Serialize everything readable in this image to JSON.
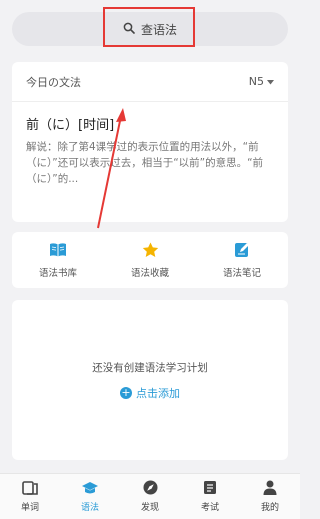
{
  "search": {
    "placeholder": "查语法"
  },
  "grammar_of_day": {
    "header": "今日の文法",
    "level": "N5",
    "title": "前（に）[时间]",
    "description": "解说：除了第4课学过的表示位置的用法以外，“前（に）”还可以表示过去，相当于“以前”的意思。“前（に）”的..."
  },
  "tools": [
    {
      "label": "语法书库",
      "icon": "book-icon"
    },
    {
      "label": "语法收藏",
      "icon": "star-icon"
    },
    {
      "label": "语法笔记",
      "icon": "note-icon"
    }
  ],
  "plan": {
    "empty_text": "还没有创建语法学习计划",
    "add_label": "点击添加"
  },
  "tabs": [
    {
      "label": "单词",
      "icon": "flashcard-icon",
      "active": false
    },
    {
      "label": "语法",
      "icon": "graduation-cap-icon",
      "active": true
    },
    {
      "label": "发现",
      "icon": "compass-icon",
      "active": false
    },
    {
      "label": "考试",
      "icon": "exam-icon",
      "active": false
    },
    {
      "label": "我的",
      "icon": "person-icon",
      "active": false
    }
  ],
  "colors": {
    "accent": "#2a9bd6",
    "star": "#f5b400",
    "annotation": "#e53935",
    "background": "#f2f2f4"
  }
}
